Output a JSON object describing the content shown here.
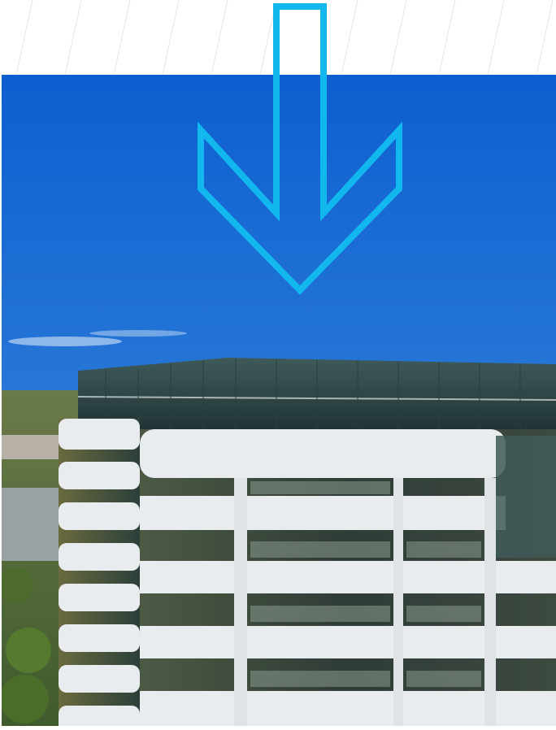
{
  "scene": {
    "subject": "office-tower-aerial-photo",
    "sky_color": "#1f6fd6",
    "arrow_color": "#12b7ee",
    "arrow_direction": "down",
    "glass_color": "#1f3d3f",
    "facade_color": "#e9ecef"
  }
}
